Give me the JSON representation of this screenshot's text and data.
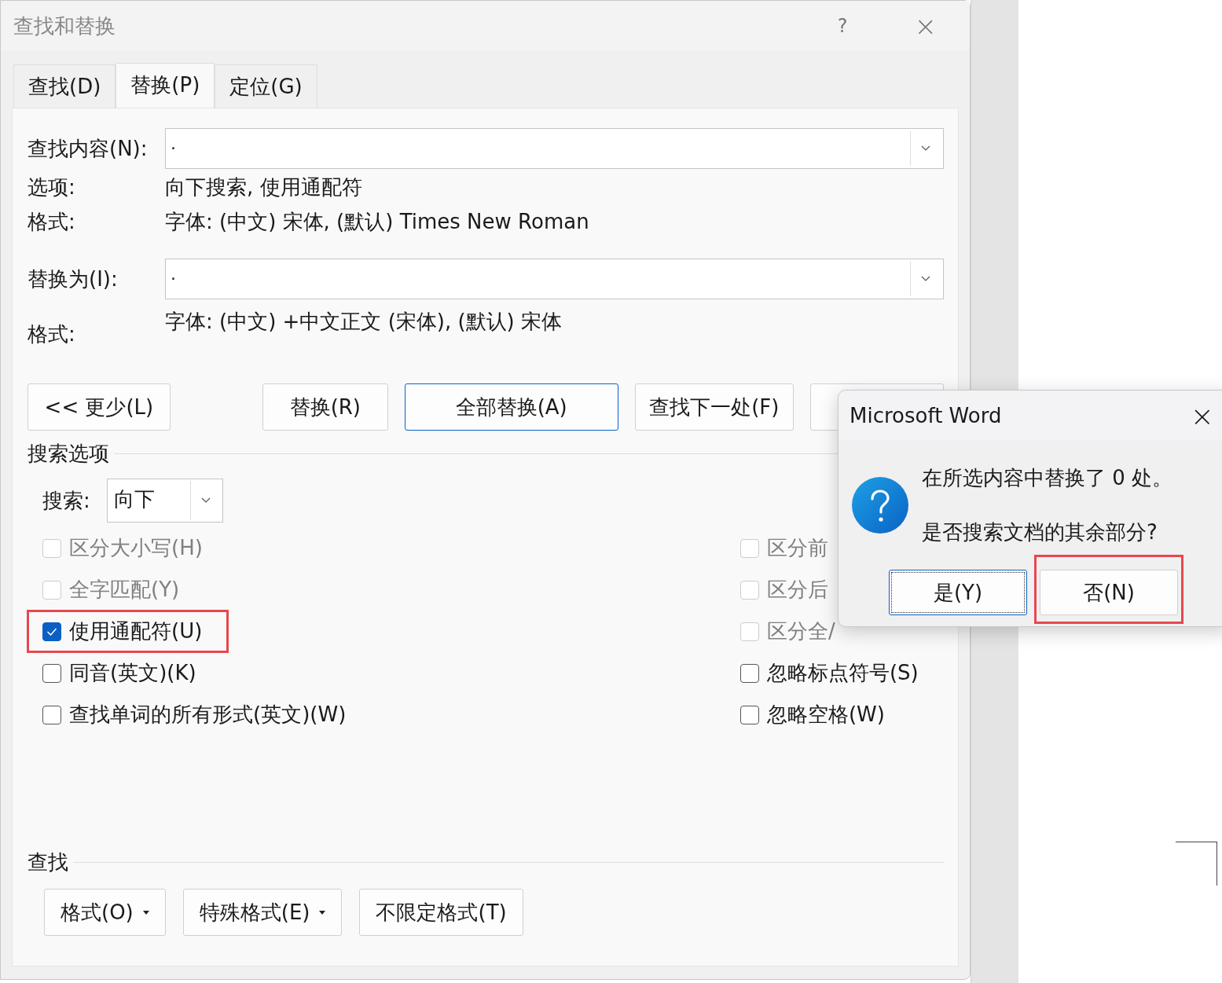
{
  "window": {
    "title": "查找和替换",
    "help": "?",
    "close": "×"
  },
  "tabs": [
    {
      "label": "查找(D)",
      "selected": false
    },
    {
      "label": "替换(P)",
      "selected": true
    },
    {
      "label": "定位(G)",
      "selected": false
    }
  ],
  "find": {
    "label": "查找内容(N):",
    "value": "."
  },
  "options": {
    "label": "选项:",
    "value": "向下搜索, 使用通配符"
  },
  "find_format": {
    "label": "格式:",
    "value": "字体: (中文) 宋体, (默认) Times New Roman"
  },
  "replace": {
    "label": "替换为(I):",
    "value": "."
  },
  "replace_format": {
    "label": "格式:",
    "value": "字体: (中文) +中文正文 (宋体), (默认) 宋体"
  },
  "buttons": [
    {
      "label": "<< 更少(L)",
      "focused": false
    },
    {
      "label": "替换(R)",
      "focused": false
    },
    {
      "label": "全部替换(A)",
      "focused": true
    },
    {
      "label": "查找下一处(F)",
      "focused": false
    }
  ],
  "search_options": {
    "title": "搜索选项",
    "direction_label": "搜索:",
    "direction": "向下"
  },
  "checkboxes_left": [
    {
      "label": "区分大小写(H)",
      "checked": false,
      "disabled": true,
      "highlighted": false
    },
    {
      "label": "全字匹配(Y)",
      "checked": false,
      "disabled": true,
      "highlighted": false
    },
    {
      "label": "使用通配符(U)",
      "checked": true,
      "disabled": false,
      "highlighted": true
    },
    {
      "label": "同音(英文)(K)",
      "checked": false,
      "disabled": false,
      "highlighted": false
    },
    {
      "label": "查找单词的所有形式(英文)(W)",
      "checked": false,
      "disabled": false,
      "highlighted": false
    }
  ],
  "checkboxes_right": [
    {
      "label": "区分前",
      "checked": false,
      "disabled": true
    },
    {
      "label": "区分后",
      "checked": false,
      "disabled": true
    },
    {
      "label": "区分全/",
      "checked": false,
      "disabled": true
    },
    {
      "label": "忽略标点符号(S)",
      "checked": false,
      "disabled": false
    },
    {
      "label": "忽略空格(W)",
      "checked": false,
      "disabled": false
    }
  ],
  "find_section": {
    "title": "查找",
    "buttons": [
      {
        "label": "格式(O)",
        "dropdown": true
      },
      {
        "label": "特殊格式(E)",
        "dropdown": true
      },
      {
        "label": "不限定格式(T)",
        "dropdown": false
      }
    ]
  },
  "message_box": {
    "title": "Microsoft Word",
    "close": "×",
    "lines": [
      "在所选内容中替换了 0 处。",
      "是否搜索文档的其余部分?"
    ],
    "buttons": [
      {
        "label": "是(Y)",
        "focused": true,
        "highlighted": false
      },
      {
        "label": "否(N)",
        "focused": false,
        "highlighted": true
      }
    ]
  }
}
